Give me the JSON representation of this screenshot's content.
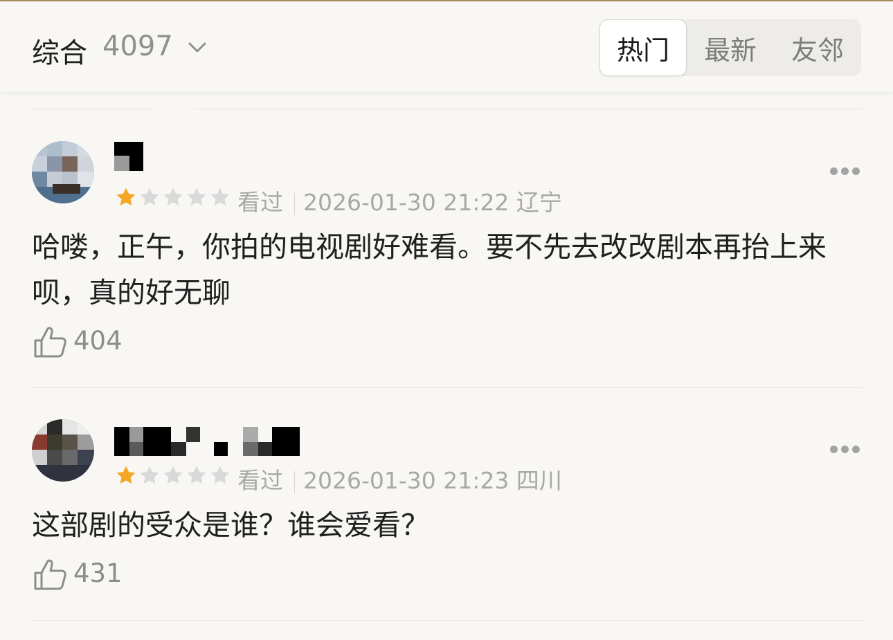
{
  "header": {
    "sort_label": "综合",
    "count": "4097",
    "tabs": [
      "热门",
      "最新",
      "友邻"
    ],
    "active_tab": 0
  },
  "colors": {
    "accent_line": "#a88a5c",
    "star_filled": "#f5a623",
    "star_empty": "#d9d9d9"
  },
  "comments": [
    {
      "rating": 1,
      "status": "看过",
      "datetime": "2026-01-30 21:22",
      "region": "辽宁",
      "text": "哈喽，正午，你拍的电视剧好难看。要不先去改改剧本再抬上来呗，真的好无聊",
      "likes": "404"
    },
    {
      "rating": 1,
      "status": "看过",
      "datetime": "2026-01-30 21:23",
      "region": "四川",
      "text": "这部剧的受众是谁？谁会爱看？",
      "likes": "431"
    }
  ],
  "icons": [
    "chevron-down-icon",
    "star-icon",
    "more-icon",
    "thumbs-up-icon"
  ]
}
